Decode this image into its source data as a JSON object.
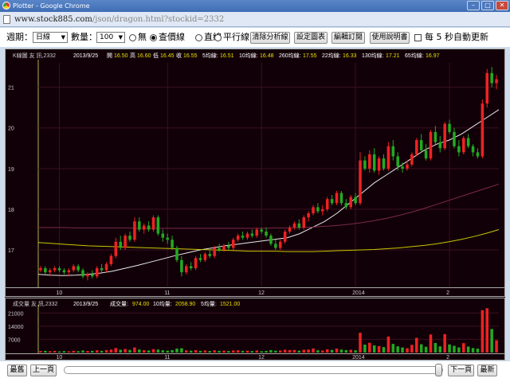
{
  "window": {
    "title": "Plotter - Google Chrome",
    "url_host": "www.stock885.com",
    "url_path": "/json/dragon.html?stockid=2332"
  },
  "toolbar": {
    "period_label": "週期：",
    "period_value": "日線",
    "count_label": "數量：",
    "count_value": "100",
    "radio_none": "無",
    "radio_price": "查價線",
    "radio_straight": "直線",
    "radio_parallel": "平行線",
    "btn_clear": "清除分析線",
    "btn_settings": "設定圖表",
    "btn_subscribe": "編輯訂閱",
    "btn_help": "使用說明書",
    "auto_update_label": "每 5 秒自動更新",
    "selected_radio": "查價線",
    "auto_update_checked": false
  },
  "kline_header": {
    "name": "K線圖 友 訊,2332",
    "date": "2013/9/25",
    "open_label": "開",
    "open": "16.50",
    "high_label": "高",
    "high": "16.60",
    "low_label": "低",
    "low": "16.45",
    "close_label": "收",
    "close": "16.55",
    "ma5_label": "5均線:",
    "ma5": "16.51",
    "ma10_label": "10均線:",
    "ma10": "16.48",
    "ma260_label": "260均線:",
    "ma260": "17.55",
    "ma22_label": "22均線:",
    "ma22": "16.33",
    "ma130_label": "130均線:",
    "ma130": "17.21",
    "ma65_label": "65均線:",
    "ma65": "16.97"
  },
  "volume_header": {
    "name": "成交量 友 訊,2332",
    "date": "2013/9/25",
    "vol_label": "成交量:",
    "vol": "974.00",
    "ma10_label": "10均量:",
    "ma10": "2058.90",
    "ma5_label": "5均量:",
    "ma5": "1521.00"
  },
  "bottom": {
    "first": "最舊",
    "prev": "上一頁",
    "next": "下一頁",
    "last": "最新",
    "slider_position": 0.97
  },
  "colors": {
    "background": "#120008",
    "up": "#ee2222",
    "down": "#22aa22",
    "ma_white": "#e8e8e8",
    "ma_yellow": "#c8c800",
    "header_value": "#e8e000"
  },
  "chart_data": {
    "type": "candlestick",
    "title": "K線圖 友 訊,2332",
    "x_ticks": [
      "10",
      "11",
      "12",
      "2014",
      "2"
    ],
    "price_ticks": [
      17,
      18,
      19,
      20,
      21
    ],
    "price_range": [
      16.1,
      21.6
    ],
    "volume_ticks": [
      "21000",
      "14000",
      "7000"
    ],
    "volume_range": [
      0,
      24500
    ],
    "candles": [
      {
        "o": 16.5,
        "h": 16.6,
        "l": 16.45,
        "c": 16.55
      },
      {
        "o": 16.55,
        "h": 16.6,
        "l": 16.4,
        "c": 16.45
      },
      {
        "o": 16.45,
        "h": 16.55,
        "l": 16.35,
        "c": 16.5
      },
      {
        "o": 16.5,
        "h": 16.6,
        "l": 16.45,
        "c": 16.55
      },
      {
        "o": 16.55,
        "h": 16.6,
        "l": 16.45,
        "c": 16.5
      },
      {
        "o": 16.5,
        "h": 16.55,
        "l": 16.4,
        "c": 16.45
      },
      {
        "o": 16.45,
        "h": 16.55,
        "l": 16.35,
        "c": 16.5
      },
      {
        "o": 16.5,
        "h": 16.65,
        "l": 16.45,
        "c": 16.6
      },
      {
        "o": 16.6,
        "h": 16.65,
        "l": 16.45,
        "c": 16.5
      },
      {
        "o": 16.5,
        "h": 16.55,
        "l": 16.3,
        "c": 16.35
      },
      {
        "o": 16.35,
        "h": 16.45,
        "l": 16.25,
        "c": 16.4
      },
      {
        "o": 16.4,
        "h": 16.5,
        "l": 16.3,
        "c": 16.35
      },
      {
        "o": 16.35,
        "h": 16.6,
        "l": 16.3,
        "c": 16.55
      },
      {
        "o": 16.55,
        "h": 16.65,
        "l": 16.45,
        "c": 16.5
      },
      {
        "o": 16.5,
        "h": 16.7,
        "l": 16.45,
        "c": 16.65
      },
      {
        "o": 16.65,
        "h": 16.9,
        "l": 16.6,
        "c": 16.85
      },
      {
        "o": 16.85,
        "h": 17.3,
        "l": 16.8,
        "c": 17.2
      },
      {
        "o": 17.2,
        "h": 17.35,
        "l": 17.0,
        "c": 17.05
      },
      {
        "o": 17.05,
        "h": 17.4,
        "l": 17.0,
        "c": 17.35
      },
      {
        "o": 17.35,
        "h": 17.45,
        "l": 17.2,
        "c": 17.25
      },
      {
        "o": 17.25,
        "h": 17.8,
        "l": 17.2,
        "c": 17.7
      },
      {
        "o": 17.7,
        "h": 17.8,
        "l": 17.45,
        "c": 17.5
      },
      {
        "o": 17.5,
        "h": 17.65,
        "l": 17.4,
        "c": 17.6
      },
      {
        "o": 17.6,
        "h": 17.7,
        "l": 17.45,
        "c": 17.5
      },
      {
        "o": 17.5,
        "h": 17.85,
        "l": 17.45,
        "c": 17.8
      },
      {
        "o": 17.8,
        "h": 17.85,
        "l": 17.35,
        "c": 17.4
      },
      {
        "o": 17.4,
        "h": 17.5,
        "l": 17.2,
        "c": 17.3
      },
      {
        "o": 17.3,
        "h": 17.4,
        "l": 17.15,
        "c": 17.25
      },
      {
        "o": 17.25,
        "h": 17.35,
        "l": 17.0,
        "c": 17.05
      },
      {
        "o": 17.05,
        "h": 17.1,
        "l": 16.7,
        "c": 16.75
      },
      {
        "o": 16.75,
        "h": 16.85,
        "l": 16.35,
        "c": 16.45
      },
      {
        "o": 16.45,
        "h": 16.65,
        "l": 16.4,
        "c": 16.6
      },
      {
        "o": 16.6,
        "h": 16.7,
        "l": 16.5,
        "c": 16.55
      },
      {
        "o": 16.55,
        "h": 16.85,
        "l": 16.5,
        "c": 16.8
      },
      {
        "o": 16.8,
        "h": 16.9,
        "l": 16.7,
        "c": 16.75
      },
      {
        "o": 16.75,
        "h": 16.95,
        "l": 16.7,
        "c": 16.9
      },
      {
        "o": 16.9,
        "h": 17.0,
        "l": 16.8,
        "c": 16.85
      },
      {
        "o": 16.85,
        "h": 17.1,
        "l": 16.8,
        "c": 17.05
      },
      {
        "o": 17.05,
        "h": 17.15,
        "l": 16.95,
        "c": 17.0
      },
      {
        "o": 17.0,
        "h": 17.15,
        "l": 16.95,
        "c": 17.1
      },
      {
        "o": 17.1,
        "h": 17.2,
        "l": 17.0,
        "c": 17.05
      },
      {
        "o": 17.05,
        "h": 17.3,
        "l": 17.0,
        "c": 17.25
      },
      {
        "o": 17.25,
        "h": 17.4,
        "l": 17.2,
        "c": 17.35
      },
      {
        "o": 17.35,
        "h": 17.45,
        "l": 17.25,
        "c": 17.3
      },
      {
        "o": 17.3,
        "h": 17.45,
        "l": 17.25,
        "c": 17.4
      },
      {
        "o": 17.4,
        "h": 17.5,
        "l": 17.3,
        "c": 17.35
      },
      {
        "o": 17.35,
        "h": 17.55,
        "l": 17.3,
        "c": 17.5
      },
      {
        "o": 17.5,
        "h": 17.55,
        "l": 17.4,
        "c": 17.45
      },
      {
        "o": 17.45,
        "h": 17.55,
        "l": 17.3,
        "c": 17.35
      },
      {
        "o": 17.35,
        "h": 17.4,
        "l": 17.1,
        "c": 17.15
      },
      {
        "o": 17.15,
        "h": 17.25,
        "l": 17.0,
        "c": 17.05
      },
      {
        "o": 17.05,
        "h": 17.25,
        "l": 17.0,
        "c": 17.2
      },
      {
        "o": 17.2,
        "h": 17.5,
        "l": 17.15,
        "c": 17.45
      },
      {
        "o": 17.45,
        "h": 17.6,
        "l": 17.4,
        "c": 17.55
      },
      {
        "o": 17.55,
        "h": 17.7,
        "l": 17.5,
        "c": 17.65
      },
      {
        "o": 17.65,
        "h": 17.75,
        "l": 17.5,
        "c": 17.55
      },
      {
        "o": 17.55,
        "h": 17.85,
        "l": 17.5,
        "c": 17.8
      },
      {
        "o": 17.8,
        "h": 17.95,
        "l": 17.7,
        "c": 17.9
      },
      {
        "o": 17.9,
        "h": 18.1,
        "l": 17.85,
        "c": 18.05
      },
      {
        "o": 18.05,
        "h": 18.15,
        "l": 17.9,
        "c": 17.95
      },
      {
        "o": 17.95,
        "h": 18.1,
        "l": 17.85,
        "c": 18.0
      },
      {
        "o": 18.0,
        "h": 18.3,
        "l": 17.95,
        "c": 18.25
      },
      {
        "o": 18.25,
        "h": 18.35,
        "l": 18.1,
        "c": 18.15
      },
      {
        "o": 18.15,
        "h": 18.45,
        "l": 18.1,
        "c": 18.4
      },
      {
        "o": 18.4,
        "h": 18.45,
        "l": 18.1,
        "c": 18.15
      },
      {
        "o": 18.15,
        "h": 18.25,
        "l": 18.0,
        "c": 18.05
      },
      {
        "o": 18.05,
        "h": 18.35,
        "l": 18.0,
        "c": 18.3
      },
      {
        "o": 18.3,
        "h": 18.4,
        "l": 18.1,
        "c": 18.15
      },
      {
        "o": 18.15,
        "h": 19.4,
        "l": 18.1,
        "c": 19.2
      },
      {
        "o": 19.2,
        "h": 19.3,
        "l": 18.95,
        "c": 19.0
      },
      {
        "o": 19.0,
        "h": 19.45,
        "l": 18.9,
        "c": 19.35
      },
      {
        "o": 19.35,
        "h": 19.5,
        "l": 18.9,
        "c": 18.95
      },
      {
        "o": 18.95,
        "h": 19.3,
        "l": 18.85,
        "c": 19.25
      },
      {
        "o": 19.25,
        "h": 19.35,
        "l": 18.95,
        "c": 19.0
      },
      {
        "o": 19.0,
        "h": 19.65,
        "l": 18.95,
        "c": 19.55
      },
      {
        "o": 19.55,
        "h": 19.7,
        "l": 19.2,
        "c": 19.3
      },
      {
        "o": 19.3,
        "h": 19.4,
        "l": 18.95,
        "c": 19.05
      },
      {
        "o": 19.05,
        "h": 19.15,
        "l": 18.9,
        "c": 19.0
      },
      {
        "o": 19.0,
        "h": 19.2,
        "l": 18.95,
        "c": 19.1
      },
      {
        "o": 19.1,
        "h": 19.4,
        "l": 19.05,
        "c": 19.35
      },
      {
        "o": 19.35,
        "h": 19.75,
        "l": 19.3,
        "c": 19.7
      },
      {
        "o": 19.7,
        "h": 19.85,
        "l": 19.4,
        "c": 19.45
      },
      {
        "o": 19.45,
        "h": 19.6,
        "l": 19.2,
        "c": 19.25
      },
      {
        "o": 19.25,
        "h": 19.95,
        "l": 19.2,
        "c": 19.9
      },
      {
        "o": 19.9,
        "h": 20.05,
        "l": 19.6,
        "c": 19.65
      },
      {
        "o": 19.65,
        "h": 19.8,
        "l": 19.4,
        "c": 19.5
      },
      {
        "o": 19.5,
        "h": 20.15,
        "l": 19.45,
        "c": 20.1
      },
      {
        "o": 20.1,
        "h": 20.2,
        "l": 19.85,
        "c": 19.9
      },
      {
        "o": 19.9,
        "h": 20.0,
        "l": 19.5,
        "c": 19.55
      },
      {
        "o": 19.55,
        "h": 19.7,
        "l": 19.3,
        "c": 19.4
      },
      {
        "o": 19.4,
        "h": 19.8,
        "l": 19.35,
        "c": 19.75
      },
      {
        "o": 19.75,
        "h": 19.85,
        "l": 19.5,
        "c": 19.55
      },
      {
        "o": 19.55,
        "h": 19.6,
        "l": 19.3,
        "c": 19.4
      },
      {
        "o": 19.4,
        "h": 19.5,
        "l": 19.25,
        "c": 19.3
      },
      {
        "o": 19.3,
        "h": 20.7,
        "l": 19.25,
        "c": 20.6
      },
      {
        "o": 20.6,
        "h": 21.45,
        "l": 20.5,
        "c": 21.35
      },
      {
        "o": 21.35,
        "h": 21.5,
        "l": 21.0,
        "c": 21.1
      },
      {
        "o": 21.1,
        "h": 21.3,
        "l": 20.95,
        "c": 21.2
      }
    ],
    "volumes": [
      800,
      900,
      700,
      850,
      600,
      750,
      650,
      900,
      700,
      1100,
      800,
      900,
      1200,
      900,
      1300,
      1600,
      2400,
      1500,
      1900,
      1400,
      2700,
      1600,
      1300,
      1100,
      1800,
      1600,
      1200,
      1000,
      1300,
      2100,
      2300,
      1200,
      1000,
      1300,
      900,
      1100,
      800,
      1200,
      900,
      1000,
      800,
      1100,
      1200,
      900,
      1000,
      800,
      1100,
      700,
      900,
      1300,
      1000,
      1100,
      1500,
      1300,
      1400,
      1000,
      1500,
      1600,
      2200,
      1200,
      1100,
      1700,
      1400,
      2100,
      1600,
      1300,
      1500,
      1200,
      10500,
      4200,
      5200,
      3800,
      3400,
      2900,
      8500,
      4600,
      3300,
      2700,
      2300,
      4100,
      7800,
      4400,
      3100,
      9600,
      5100,
      3300,
      9800,
      4300,
      3600,
      2700,
      5000,
      3200,
      2400,
      2100,
      22500,
      23500,
      12500,
      6500
    ],
    "ma_lines": [
      {
        "color": "#e8e8e8",
        "values": [
          16.4,
          16.38,
          16.37,
          16.38,
          16.4,
          16.43,
          16.48,
          16.55,
          16.62,
          16.7,
          16.78,
          16.86,
          16.93,
          17.0,
          17.05,
          17.1,
          17.14,
          17.18,
          17.22,
          17.26,
          17.3,
          17.4,
          17.55,
          17.7,
          17.9,
          18.15,
          18.4,
          18.65,
          18.85,
          19.05,
          19.25,
          19.45,
          19.6,
          19.7,
          19.85,
          20.05,
          20.25,
          20.45
        ]
      },
      {
        "color": "#c8c800",
        "values": [
          17.18,
          17.16,
          17.14,
          17.12,
          17.1,
          17.09,
          17.08,
          17.07,
          17.06,
          17.05,
          17.04,
          17.03,
          17.02,
          17.01,
          17.0,
          16.99,
          16.98,
          16.97,
          16.97,
          16.97,
          16.96,
          16.96,
          16.96,
          16.97,
          16.98,
          16.99,
          17.0,
          17.01,
          17.03,
          17.05,
          17.08,
          17.11,
          17.15,
          17.2,
          17.26,
          17.33,
          17.41,
          17.5
        ]
      },
      {
        "color": "#7a2a4a",
        "values": [
          17.55,
          17.55,
          17.55,
          17.54,
          17.54,
          17.54,
          17.54,
          17.54,
          17.53,
          17.53,
          17.53,
          17.53,
          17.53,
          17.53,
          17.53,
          17.53,
          17.53,
          17.53,
          17.53,
          17.54,
          17.54,
          17.55,
          17.56,
          17.58,
          17.6,
          17.63,
          17.67,
          17.72,
          17.78,
          17.85,
          17.93,
          18.02,
          18.12,
          18.22,
          18.32,
          18.42,
          18.52,
          18.62
        ]
      }
    ]
  }
}
